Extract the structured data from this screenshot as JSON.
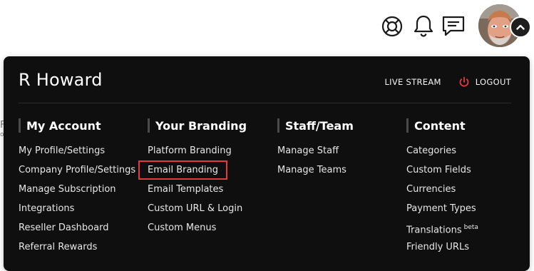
{
  "topbar": {
    "icons": [
      "lifebuoy-icon",
      "bell-icon",
      "chat-icon"
    ],
    "avatar_alt": "User avatar",
    "toggle_icon": "chevron-up-icon"
  },
  "background_fragments": {
    "line1": "F",
    "line2": "o"
  },
  "menu": {
    "user_name": "R Howard",
    "live_stream": "LIVE STREAM",
    "logout": "LOGOUT",
    "colors": {
      "panel": "#0f0f0f",
      "accent": "#e53940"
    },
    "columns": [
      {
        "title": "My Account",
        "items": [
          "My Profile/Settings",
          "Company Profile/Settings",
          "Manage Subscription",
          "Integrations",
          "Reseller Dashboard",
          "Referral Rewards"
        ]
      },
      {
        "title": "Your Branding",
        "items": [
          "Platform Branding",
          "Email Branding",
          "Email Templates",
          "Custom URL & Login",
          "Custom Menus"
        ]
      },
      {
        "title": "Staff/Team",
        "items": [
          "Manage Staff",
          "Manage Teams"
        ]
      },
      {
        "title": "Content",
        "items": [
          "Categories",
          "Custom Fields",
          "Currencies",
          "Payment Types",
          "Translations",
          "Friendly URLs"
        ],
        "translations_badge": "beta"
      }
    ]
  }
}
